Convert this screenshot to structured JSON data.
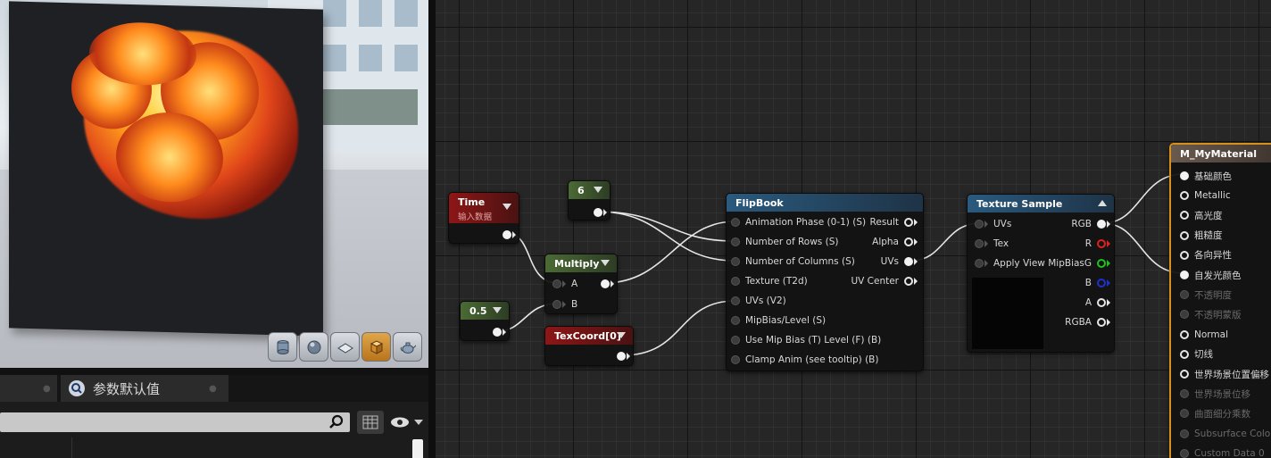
{
  "bottom_panel": {
    "tab_label": "参数默认值",
    "search_placeholder": ""
  },
  "viewport": {
    "tools": [
      "cylinder-icon",
      "sphere-icon",
      "plane-icon",
      "cube-icon",
      "teapot-icon"
    ],
    "active_tool": "cube-icon"
  },
  "nodes": {
    "time": {
      "title": "Time",
      "subtitle": "输入数据"
    },
    "const6": {
      "title": "6"
    },
    "const05": {
      "title": "0.5"
    },
    "multiply": {
      "title": "Multiply",
      "pin_a": "A",
      "pin_b": "B"
    },
    "texcoord": {
      "title": "TexCoord[0]"
    },
    "flipbook": {
      "title": "FlipBook",
      "inputs": [
        "Animation Phase (0-1) (S)",
        "Number of Rows (S)",
        "Number of Columns (S)",
        "Texture (T2d)",
        "UVs (V2)",
        "MipBias/Level (S)",
        "Use Mip Bias (T) Level (F) (B)",
        "Clamp Anim (see tooltip) (B)"
      ],
      "outputs": [
        "Result",
        "Alpha",
        "UVs",
        "UV Center"
      ]
    },
    "texture_sample": {
      "title": "Texture Sample",
      "inputs": [
        "UVs",
        "Tex",
        "Apply View MipBias"
      ],
      "outputs": [
        "RGB",
        "R",
        "G",
        "B",
        "A",
        "RGBA"
      ]
    },
    "material": {
      "title": "M_MyMaterial",
      "inputs": [
        "基础颜色",
        "Metallic",
        "高光度",
        "粗糙度",
        "各向异性",
        "自发光颜色",
        "不透明度",
        "不透明蒙版",
        "Normal",
        "切线",
        "世界场景位置偏移",
        "世界场景位移",
        "曲面细分乘数",
        "Subsurface Color",
        "Custom Data 0"
      ],
      "disabled": [
        false,
        false,
        false,
        false,
        false,
        false,
        true,
        true,
        false,
        false,
        false,
        true,
        true,
        true,
        true
      ]
    }
  },
  "colors": {
    "time_header": "#8d1616",
    "constant_header": "#4b6a34",
    "function_header": "#2a5a7e",
    "material_border": "#d8901c"
  }
}
